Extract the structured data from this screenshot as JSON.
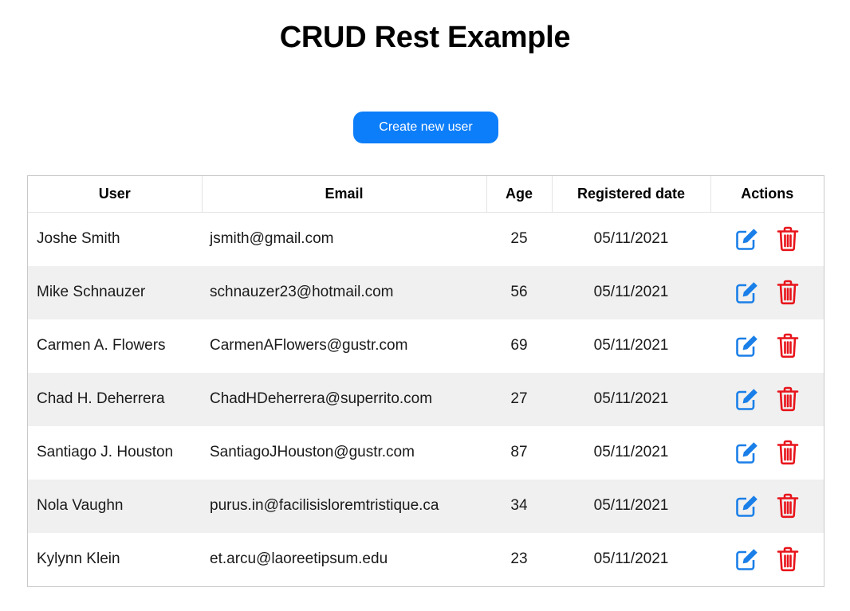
{
  "title": "CRUD Rest Example",
  "create_button_label": "Create new user",
  "colors": {
    "primary": "#0d7ef9",
    "edit_icon": "#1a7fe8",
    "delete_icon": "#e8141b",
    "stripe": "#f0f0f0"
  },
  "table": {
    "headers": {
      "user": "User",
      "email": "Email",
      "age": "Age",
      "registered": "Registered date",
      "actions": "Actions"
    },
    "rows": [
      {
        "user": "Joshe Smith",
        "email": "jsmith@gmail.com",
        "age": "25",
        "registered": "05/11/2021"
      },
      {
        "user": "Mike Schnauzer",
        "email": "schnauzer23@hotmail.com",
        "age": "56",
        "registered": "05/11/2021"
      },
      {
        "user": "Carmen A. Flowers",
        "email": "CarmenAFlowers@gustr.com",
        "age": "69",
        "registered": "05/11/2021"
      },
      {
        "user": "Chad H. Deherrera",
        "email": "ChadHDeherrera@superrito.com",
        "age": "27",
        "registered": "05/11/2021"
      },
      {
        "user": "Santiago J. Houston",
        "email": "SantiagoJHouston@gustr.com",
        "age": "87",
        "registered": "05/11/2021"
      },
      {
        "user": "Nola Vaughn",
        "email": "purus.in@facilisisloremtristique.ca",
        "age": "34",
        "registered": "05/11/2021"
      },
      {
        "user": "Kylynn Klein",
        "email": "et.arcu@laoreetipsum.edu",
        "age": "23",
        "registered": "05/11/2021"
      }
    ],
    "row_actions": [
      {
        "icon": "edit-icon"
      },
      {
        "icon": "trash-icon"
      }
    ]
  }
}
